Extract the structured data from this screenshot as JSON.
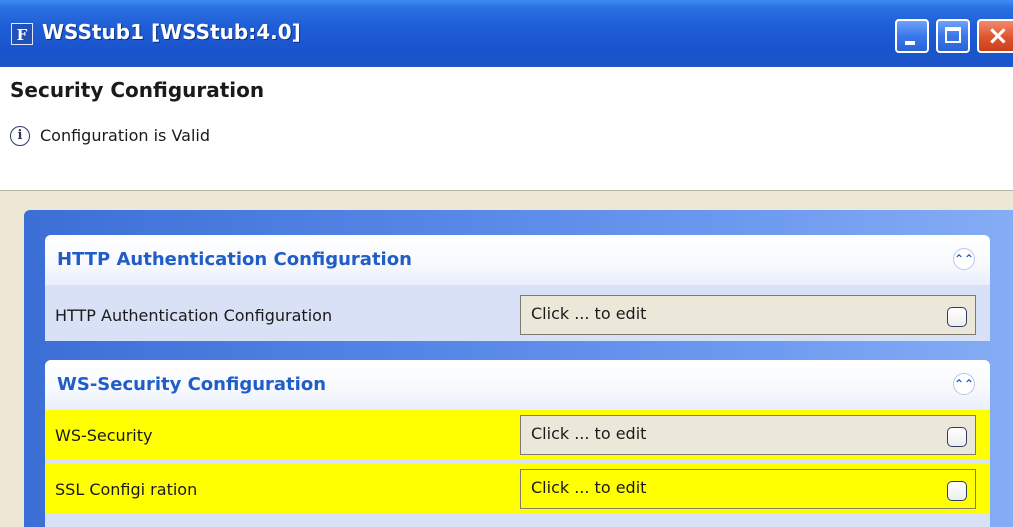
{
  "window": {
    "icon_letter": "F",
    "title": "WSStub1 [WSStub:4.0]",
    "controls": {
      "minimize": "minimize",
      "maximize": "maximize",
      "close": "×"
    }
  },
  "header": {
    "heading": "Security Configuration",
    "status_icon": "i",
    "status_text": "Configuration is Valid"
  },
  "sections": [
    {
      "title": "HTTP Authentication Configuration",
      "collapse_icon": "chevron-double-up-icon",
      "collapse_glyph": "⌃⌃",
      "rows": [
        {
          "label": "HTTP Authentication Configuration",
          "value": "Click ... to edit",
          "highlighted": false
        }
      ]
    },
    {
      "title": "WS-Security Configuration",
      "collapse_icon": "chevron-double-up-icon",
      "collapse_glyph": "⌃⌃",
      "rows": [
        {
          "label": "WS-Security",
          "value": "Click ... to edit",
          "highlighted": true
        },
        {
          "label": "SSL Configi ration",
          "value": "Click ... to edit",
          "highlighted": true
        }
      ]
    }
  ],
  "colors": {
    "titlebar": "#1f5dd6",
    "section_title": "#215dc6",
    "highlight": "#ffff00",
    "panel_blue": "#5585e6"
  }
}
